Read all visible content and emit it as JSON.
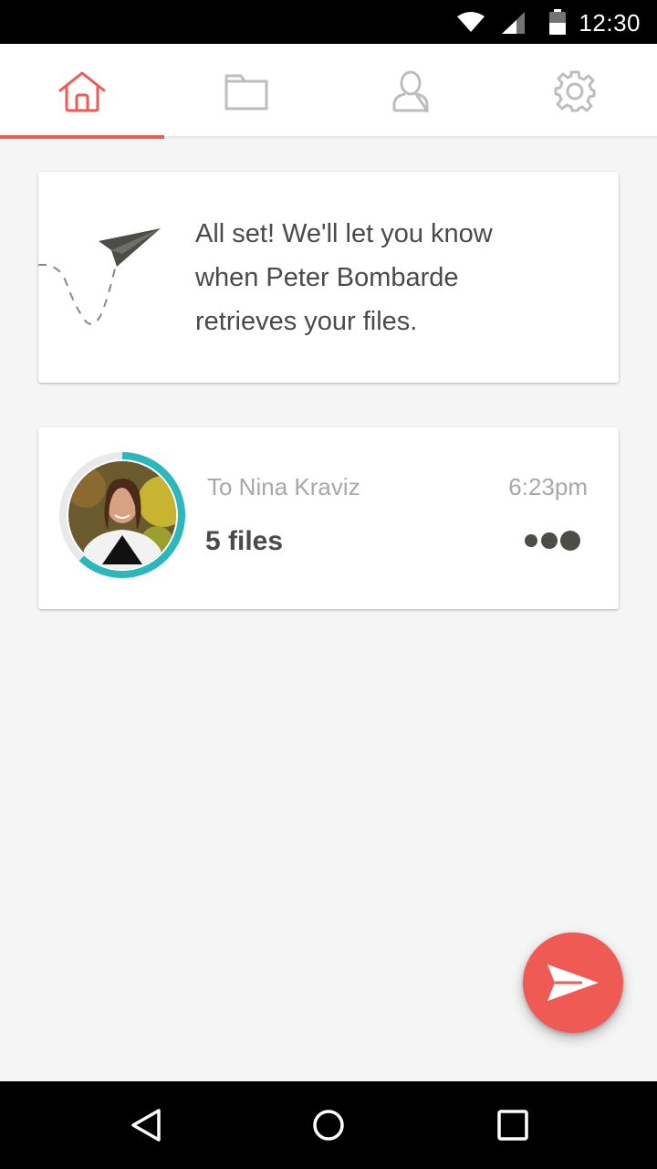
{
  "status_bar": {
    "time": "12:30",
    "icons": [
      "wifi-icon",
      "signal-icon",
      "battery-icon"
    ]
  },
  "tabs": [
    {
      "name": "home",
      "icon": "home-icon",
      "active": true
    },
    {
      "name": "files",
      "icon": "folder-icon",
      "active": false
    },
    {
      "name": "profile",
      "icon": "user-icon",
      "active": false
    },
    {
      "name": "settings",
      "icon": "gear-icon",
      "active": false
    }
  ],
  "confirmation": {
    "icon": "paper-plane-icon",
    "line1": "All set! We'll let you know",
    "line2": "when Peter Bombarde",
    "line3": "retrieves your files."
  },
  "transfer": {
    "recipient": "To Nina Kraviz",
    "time": "6:23pm",
    "files": "5 files",
    "progress": 0.62,
    "more_icon": "more-dots-icon"
  },
  "fab": {
    "icon": "send-icon"
  },
  "colors": {
    "accent": "#f05a55",
    "progress": "#2ab8bd",
    "text_dark": "#4a4a4a",
    "text_light": "#a8a8a8",
    "icon_inactive": "#bdbdbd"
  },
  "nav_bar": {
    "icons": [
      "back-icon",
      "home-circle-icon",
      "recents-icon"
    ]
  }
}
